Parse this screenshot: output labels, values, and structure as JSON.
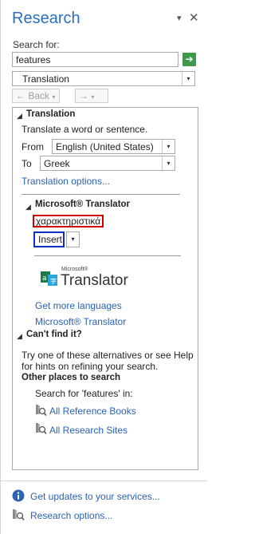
{
  "pane": {
    "title": "Research",
    "dropdown_glyph": "▾",
    "close_glyph": "✕"
  },
  "search": {
    "label": "Search for:",
    "value": "features",
    "go_glyph": "➔",
    "source_value": "Translation",
    "back_label": "Back",
    "back_glyph": "←",
    "forward_glyph": "→",
    "arrow_glyph": "▾"
  },
  "results": {
    "collapse_glyph": "◢",
    "translation_header": "Translation",
    "translation_desc": "Translate a word or sentence.",
    "from_label": "From",
    "from_value": "English (United States)",
    "to_label": "To",
    "to_value": "Greek",
    "options_link": "Translation options...",
    "ms_header": "Microsoft® Translator",
    "translated_text": "χαρακτηριστικά",
    "insert_label": "Insert",
    "logo_small": "Microsoft®",
    "logo_big": "Translator",
    "get_more_link": "Get more languages",
    "ms_link": "Microsoft® Translator",
    "cant_find_header": "Can't find it?",
    "cant_find_text_1": "Try one of these alternatives or see Help",
    "cant_find_text_2": "for hints on refining your search.",
    "other_places_header": "Other places to search",
    "search_for_in": "Search for 'features' in:",
    "ref_books_link": "All Reference Books",
    "research_sites_link": "All Research Sites"
  },
  "footer": {
    "updates_link": "Get updates to your services...",
    "options_link": "Research options..."
  },
  "colors": {
    "title": "#2a6ebb",
    "link": "#2b62b2",
    "go_button": "#3c9a49",
    "highlight_red": "#d00000",
    "highlight_blue": "#1030c8"
  }
}
